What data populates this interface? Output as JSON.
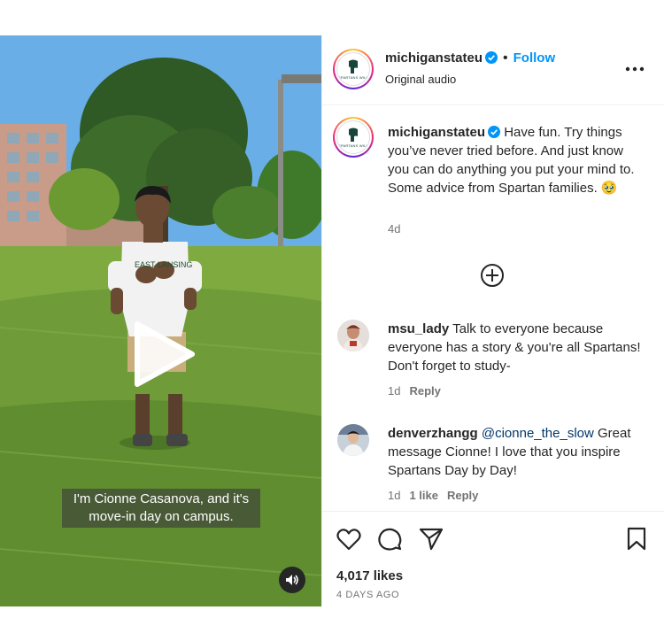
{
  "post": {
    "username": "michiganstateu",
    "follow_label": "Follow",
    "separator": "•",
    "audio_label": "Original audio",
    "avatar_text": "SPARTANS WILL",
    "caption_text": "Have fun. Try things you’ve never tried before. And just know you can do anything you put your mind to. Some advice from Spartan families. 🥹",
    "caption_age": "4d"
  },
  "video": {
    "subtitle_line1": "I'm Cionne Casanova, and it's",
    "subtitle_line2": "move-in day on campus.",
    "shirt_text": "EAST LANSING"
  },
  "comments": [
    {
      "username": "msu_lady",
      "text": "Talk to everyone because everyone has a story & you're all Spartans! Don't forget to study-",
      "age": "1d",
      "likes": "",
      "reply_label": "Reply"
    },
    {
      "username": "denverzhangg",
      "mention": "@cionne_the_slow",
      "text": "Great message Cionne! I love that you inspire Spartans Day by Day!",
      "age": "1d",
      "likes": "1 like",
      "reply_label": "Reply"
    }
  ],
  "footer": {
    "likes": "4,017 likes",
    "time_ago": "4 DAYS AGO"
  },
  "icons": [
    "verified-badge-icon",
    "more-options-icon",
    "add-comment-icon",
    "play-icon",
    "mute-icon",
    "heart-icon",
    "comment-icon",
    "share-icon",
    "bookmark-icon"
  ],
  "colors": {
    "accent": "#0095f6",
    "msu_green": "#18453b",
    "text": "#262626",
    "muted": "#737373"
  }
}
